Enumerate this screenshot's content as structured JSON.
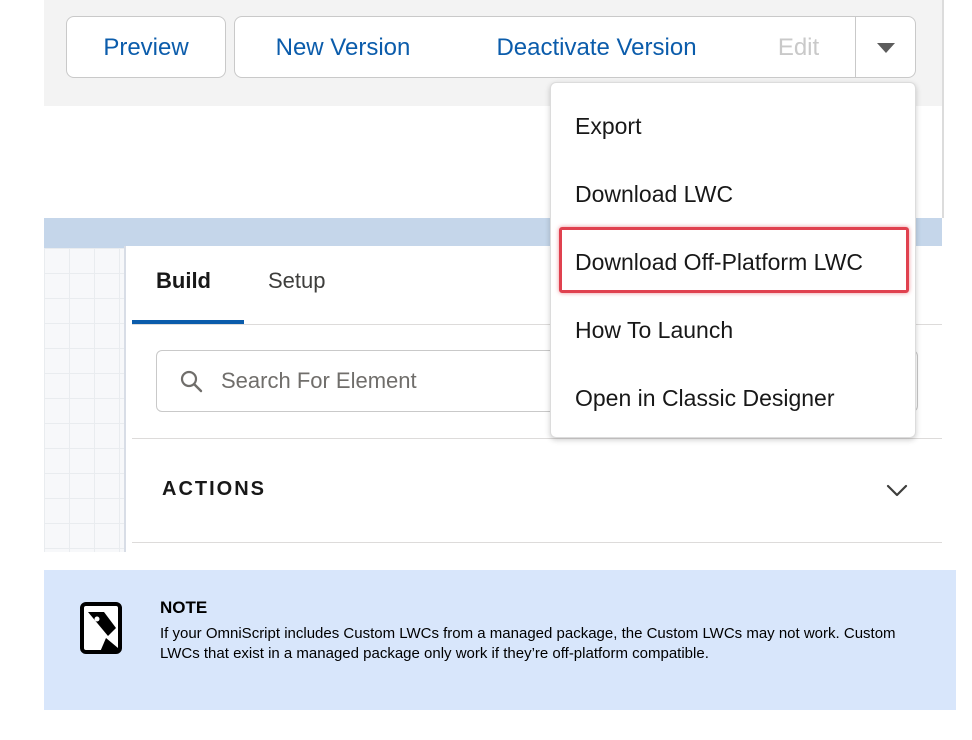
{
  "toolbar": {
    "preview_label": "Preview",
    "new_version_label": "New Version",
    "deactivate_label": "Deactivate Version",
    "edit_label": "Edit",
    "more_icon": "chevron-down-icon"
  },
  "menu": {
    "items": [
      {
        "label": "Export"
      },
      {
        "label": "Download LWC"
      },
      {
        "label": "Download Off-Platform LWC",
        "highlighted": true
      },
      {
        "label": "How To Launch"
      },
      {
        "label": "Open in Classic Designer"
      }
    ]
  },
  "builder": {
    "tabs": [
      {
        "label": "Build",
        "active": true
      },
      {
        "label": "Setup",
        "active": false
      }
    ],
    "search": {
      "placeholder": "Search For Element",
      "icon": "search-icon"
    },
    "section": {
      "title": "ACTIONS",
      "icon": "chevron-down-icon"
    }
  },
  "note": {
    "icon": "note-icon",
    "title": "NOTE",
    "text": "If your OmniScript includes Custom LWCs from a managed package, the Custom LWCs may not work. Custom LWCs that exist in a managed package only work if they’re off-platform compatible."
  },
  "colors": {
    "brand_blue": "#0b5cab",
    "highlight_red": "#e0414f",
    "note_bg": "#d8e6fb",
    "toolbar_bg": "#f3f3f3"
  }
}
